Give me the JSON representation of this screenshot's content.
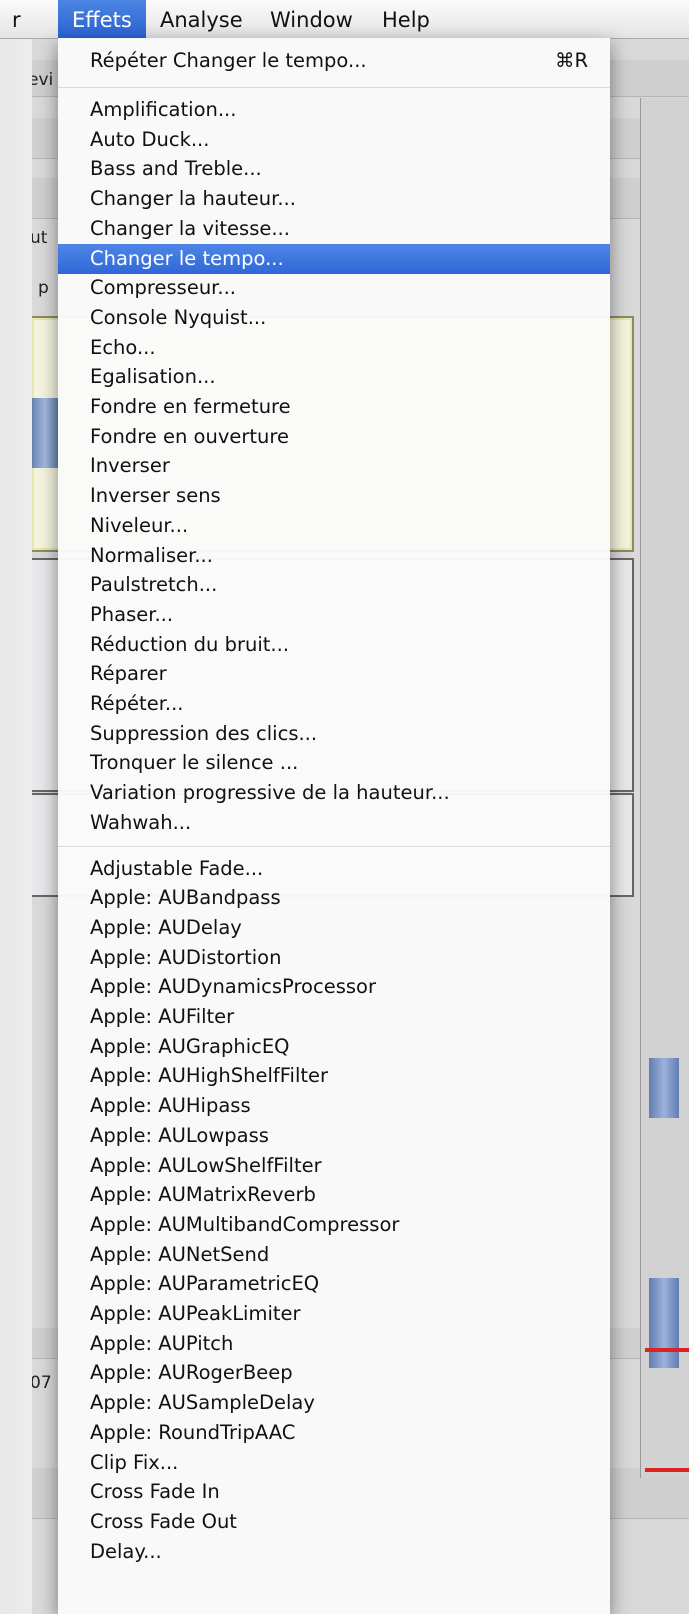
{
  "menubar": {
    "items": [
      {
        "label": "r"
      },
      {
        "label": "Effets"
      },
      {
        "label": "Analyse"
      },
      {
        "label": "Window"
      },
      {
        "label": "Help"
      }
    ]
  },
  "background": {
    "fragments": [
      "evi",
      "ut",
      "p",
      "07"
    ]
  },
  "menu": {
    "repeat": {
      "label": "Répéter Changer le tempo...",
      "shortcut": "⌘R"
    },
    "builtin": [
      "Amplification...",
      "Auto Duck...",
      "Bass and Treble...",
      "Changer la hauteur...",
      "Changer la vitesse...",
      "Changer le tempo...",
      "Compresseur...",
      "Console Nyquist...",
      "Echo...",
      "Egalisation...",
      "Fondre en fermeture",
      "Fondre en ouverture",
      "Inverser",
      "Inverser sens",
      "Niveleur...",
      "Normaliser...",
      "Paulstretch...",
      "Phaser...",
      "Réduction du bruit...",
      "Réparer",
      "Répéter...",
      "Suppression des clics...",
      "Tronquer le silence ...",
      "Variation progressive de la hauteur...",
      "Wahwah..."
    ],
    "highlighted": "Changer le tempo...",
    "plugins": [
      "Adjustable Fade...",
      "Apple: AUBandpass",
      "Apple: AUDelay",
      "Apple: AUDistortion",
      "Apple: AUDynamicsProcessor",
      "Apple: AUFilter",
      "Apple: AUGraphicEQ",
      "Apple: AUHighShelfFilter",
      "Apple: AUHipass",
      "Apple: AULowpass",
      "Apple: AULowShelfFilter",
      "Apple: AUMatrixReverb",
      "Apple: AUMultibandCompressor",
      "Apple: AUNetSend",
      "Apple: AUParametricEQ",
      "Apple: AUPeakLimiter",
      "Apple: AUPitch",
      "Apple: AURogerBeep",
      "Apple: AUSampleDelay",
      "Apple: RoundTripAAC",
      "Clip Fix...",
      "Cross Fade In",
      "Cross Fade Out",
      "Delay..."
    ]
  }
}
